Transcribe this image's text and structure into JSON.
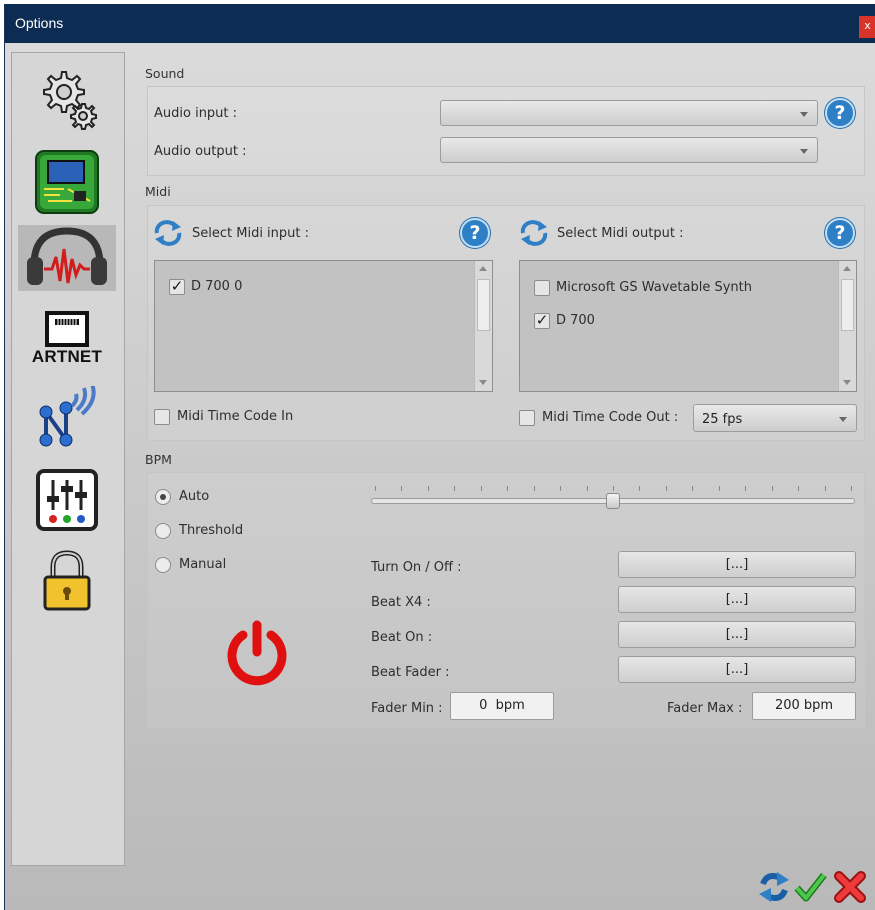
{
  "window": {
    "title": "Options",
    "close_label": "x"
  },
  "sidebar": {
    "items": [
      {
        "name": "general-settings",
        "icon": "gears-icon"
      },
      {
        "name": "hardware",
        "icon": "circuit-board-icon"
      },
      {
        "name": "sound",
        "icon": "headphones-icon",
        "selected": true
      },
      {
        "name": "artnet",
        "icon": "ethernet-port-icon",
        "label": "ARTNET"
      },
      {
        "name": "network",
        "icon": "network-wireless-icon"
      },
      {
        "name": "mixer",
        "icon": "mixer-sliders-icon"
      },
      {
        "name": "security",
        "icon": "padlock-icon"
      }
    ]
  },
  "sound": {
    "group_label": "Sound",
    "audio_input_label": "Audio input :",
    "audio_input_value": "",
    "audio_output_label": "Audio output :",
    "audio_output_value": ""
  },
  "midi": {
    "group_label": "Midi",
    "input_label": "Select Midi input :",
    "output_label": "Select Midi output :",
    "input_devices": [
      {
        "label": "D 700 0",
        "checked": true
      }
    ],
    "output_devices": [
      {
        "label": "Microsoft GS Wavetable Synth",
        "checked": false
      },
      {
        "label": "D 700",
        "checked": true
      }
    ],
    "timecode_in_label": "Midi Time Code In",
    "timecode_in_checked": false,
    "timecode_out_label": "Midi Time Code Out :",
    "timecode_out_checked": false,
    "fps_value": "25 fps"
  },
  "bpm": {
    "group_label": "BPM",
    "modes": [
      {
        "label": "Auto",
        "selected": true
      },
      {
        "label": "Threshold",
        "selected": false
      },
      {
        "label": "Manual",
        "selected": false
      }
    ],
    "slider_fraction": 0.5,
    "turn_on_off_label": "Turn On / Off :",
    "turn_on_off_value": "[...]",
    "beat_x4_label": "Beat X4 :",
    "beat_x4_value": "[...]",
    "beat_on_label": "Beat On :",
    "beat_on_value": "[...]",
    "beat_fader_label": "Beat Fader :",
    "beat_fader_value": "[...]",
    "fader_min_label": "Fader Min :",
    "fader_min_value": "0  bpm",
    "fader_max_label": "Fader Max :",
    "fader_max_value": "200 bpm"
  },
  "colors": {
    "titlebar": "#0c2c54",
    "help_blue": "#2f7fc6",
    "power_red": "#e01010",
    "ok_green": "#2fa82f",
    "cancel_red": "#e02a2a"
  }
}
